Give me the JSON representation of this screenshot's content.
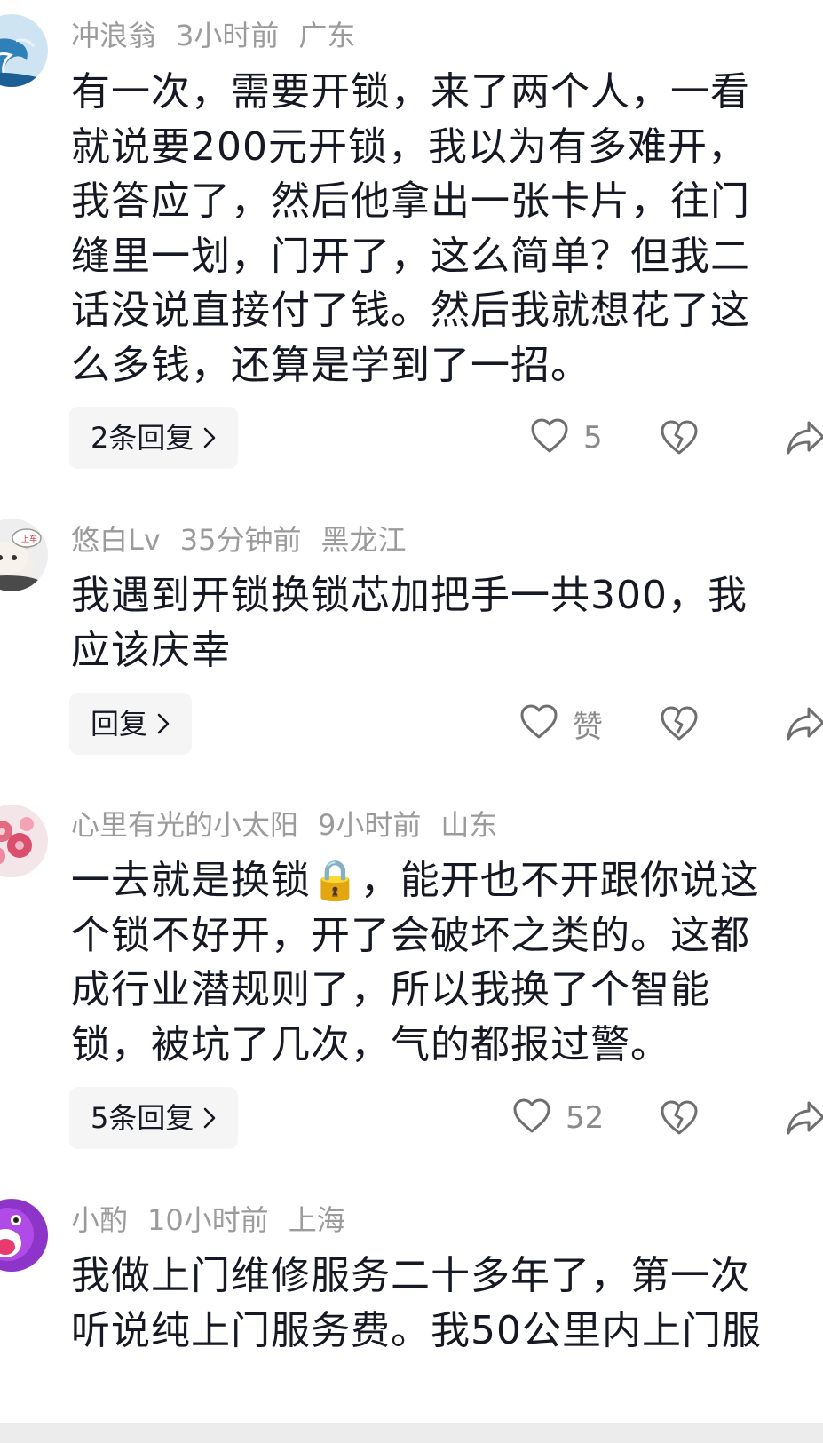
{
  "comments": [
    {
      "username": "冲浪翁",
      "time": "3小时前",
      "location": "广东",
      "lines": [
        "有一次，需要开锁，来了两个人，一看",
        "就说要200元开锁，我以为有多难开，",
        "我答应了，然后他拿出一张卡片，往门",
        "缝里一划，门开了，这么简单？但我二",
        "话没说直接付了钱。然后我就想花了这",
        "么多钱，还算是学到了一招。"
      ],
      "reply_label": "2条回复",
      "likes": "5",
      "avatar": "wave-avatar"
    },
    {
      "username": "悠白Lv",
      "time": "35分钟前",
      "location": "黑龙江",
      "lines": [
        "我遇到开锁换锁芯加把手一共300，我",
        "应该庆幸"
      ],
      "reply_label": "回复",
      "likes": "赞",
      "avatar": "cat-avatar"
    },
    {
      "username": "心里有光的小太阳",
      "time": "9小时前",
      "location": "山东",
      "lines": [
        "一去就是换锁🔒，能开也不开跟你说这",
        "个锁不好开，开了会破坏之类的。这都",
        "成行业潜规则了，所以我换了个智能",
        "锁，被坑了几次，气的都报过警。"
      ],
      "reply_label": "5条回复",
      "likes": "52",
      "avatar": "flower-avatar"
    },
    {
      "username": "小酌",
      "time": "10小时前",
      "location": "上海",
      "lines": [
        "我做上门维修服务二十多年了，第一次",
        "听说纯上门服务费。我50公里内上门服"
      ],
      "reply_label": "",
      "likes": "",
      "avatar": "purple-face-avatar"
    }
  ],
  "icons": {
    "like": "heart-outline-icon",
    "dislike": "broken-heart-icon",
    "share": "share-arrow-icon",
    "chevron": "chevron-right-icon"
  },
  "colors": {
    "text": "#161823",
    "meta": "#9b9b9b",
    "count": "#8a8a8a",
    "reply_bg": "#f5f5f5"
  }
}
